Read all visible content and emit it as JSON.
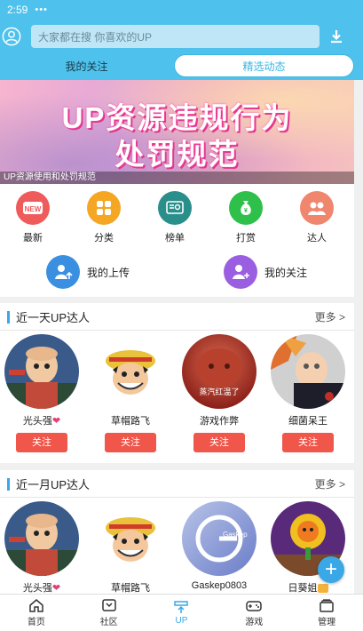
{
  "status_bar": {
    "time": "2:59",
    "dots": "•••"
  },
  "header": {
    "search_placeholder": "大家都在搜  你喜欢的UP",
    "tabs": [
      {
        "label": "我的关注",
        "selected": false
      },
      {
        "label": "精选动态",
        "selected": true
      }
    ]
  },
  "banner": {
    "line1": "UP资源违规行为",
    "line2": "处罚规范",
    "caption": "UP资源使用和处罚规范"
  },
  "menu": {
    "items": [
      {
        "label": "最新",
        "icon": "new-badge-icon",
        "color": "#ef5a5a"
      },
      {
        "label": "分类",
        "icon": "grid-icon",
        "color": "#f5a623"
      },
      {
        "label": "榜单",
        "icon": "certificate-icon",
        "color": "#2a8f8a"
      },
      {
        "label": "打赏",
        "icon": "money-bag-icon",
        "color": "#2ec04a"
      },
      {
        "label": "达人",
        "icon": "people-icon",
        "color": "#f0866e"
      }
    ],
    "wide_items": [
      {
        "label": "我的上传",
        "icon": "user-upload-icon",
        "color": "#3a8fe0"
      },
      {
        "label": "我的关注",
        "icon": "user-follow-icon",
        "color": "#9a5ee0"
      }
    ]
  },
  "section_day": {
    "title": "近一天UP达人",
    "more": "更多 >",
    "uploaders": [
      {
        "name": "光头强",
        "badge": "heart",
        "follow": "关注"
      },
      {
        "name": "草帽路飞",
        "badge": "",
        "follow": "关注"
      },
      {
        "name": "游戏作弊",
        "badge": "",
        "follow": "关注",
        "avatar_text": "蒸汽红温了"
      },
      {
        "name": "细菌呆王",
        "badge": "",
        "follow": "关注"
      }
    ]
  },
  "section_month": {
    "title": "近一月UP达人",
    "more": "更多 >",
    "uploaders": [
      {
        "name": "光头强",
        "badge": "heart"
      },
      {
        "name": "草帽路飞",
        "badge": ""
      },
      {
        "name": "Gaskep0803",
        "badge": "",
        "avatar_text": "Gaskep"
      },
      {
        "name": "日葵姐",
        "badge": "crown"
      }
    ]
  },
  "fab": {
    "label": "+"
  },
  "bottom_nav": [
    {
      "label": "首页",
      "icon": "home-icon",
      "active": false
    },
    {
      "label": "社区",
      "icon": "community-icon",
      "active": false
    },
    {
      "label": "UP",
      "icon": "upload-icon",
      "active": true
    },
    {
      "label": "游戏",
      "icon": "gamepad-icon",
      "active": false
    },
    {
      "label": "管理",
      "icon": "manage-icon",
      "active": false
    }
  ],
  "colors": {
    "primary": "#4ec2ec",
    "accent": "#3aa8e6",
    "follow": "#f0564a"
  }
}
